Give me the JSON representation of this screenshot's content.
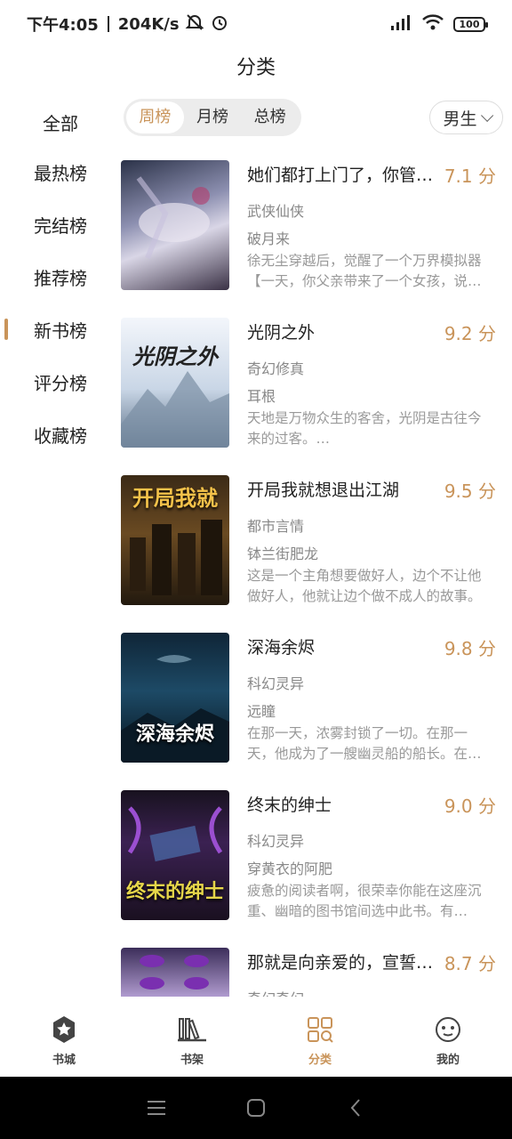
{
  "status_bar": {
    "time": "下午4:05",
    "speed": "204K/s",
    "battery": "100"
  },
  "page_title": "分类",
  "sidebar": {
    "items": [
      {
        "label": "全部"
      },
      {
        "label": "最热榜"
      },
      {
        "label": "完结榜"
      },
      {
        "label": "推荐榜"
      },
      {
        "label": "新书榜"
      },
      {
        "label": "评分榜"
      },
      {
        "label": "收藏榜"
      }
    ],
    "active_index": 4
  },
  "period_tabs": [
    {
      "label": "周榜"
    },
    {
      "label": "月榜"
    },
    {
      "label": "总榜"
    }
  ],
  "gender_select": {
    "value": "男生"
  },
  "books": [
    {
      "title": "她们都打上门了，你管这叫弱小宗门？",
      "score": "7.1 分",
      "genre": "武侠仙侠",
      "author": "破月来",
      "desc": "徐无尘穿越后，觉醒了一个万界模拟器【一天，你父亲带来了一个女孩，说她是你的未婚妻……】"
    },
    {
      "title": "光阴之外",
      "score": "9.2 分",
      "genre": "奇幻修真",
      "author": "耳根",
      "desc": "天地是万物众生的客舍，光阴是古往今来的过客。…",
      "cover_text": "光阴之外"
    },
    {
      "title": "开局我就想退出江湖",
      "score": "9.5 分",
      "genre": "都市言情",
      "author": "钵兰街肥龙",
      "desc": "这是一个主角想要做好人，边个不让他做好人，他就让边个做不成人的故事。",
      "cover_text": "开局我就"
    },
    {
      "title": "深海余烬",
      "score": "9.8 分",
      "genre": "科幻灵异",
      "author": "远瞳",
      "desc": "在那一天，浓雾封锁了一切。在那一天，他成为了一艘幽灵船的船长。在那一天……",
      "cover_text": "深海余烬"
    },
    {
      "title": "终末的绅士",
      "score": "9.0 分",
      "genre": "科幻灵异",
      "author": "穿黄衣的阿肥",
      "desc": "疲惫的阅读者啊，很荣幸你能在这座沉重、幽暗的图书馆间选中此书。有些……",
      "cover_text": "终末的绅士"
    },
    {
      "title": "那就是向亲爱的，宣誓效忠吧",
      "score": "8.7 分",
      "genre": "奇幻奇幻",
      "author": "",
      "desc": ""
    }
  ],
  "bottom_nav": [
    {
      "label": "书城",
      "icon": "star-badge-icon"
    },
    {
      "label": "书架",
      "icon": "bookshelf-icon"
    },
    {
      "label": "分类",
      "icon": "category-grid-icon"
    },
    {
      "label": "我的",
      "icon": "profile-face-icon"
    }
  ],
  "bottom_nav_active": 2,
  "colors": {
    "accent": "#c9945a"
  }
}
